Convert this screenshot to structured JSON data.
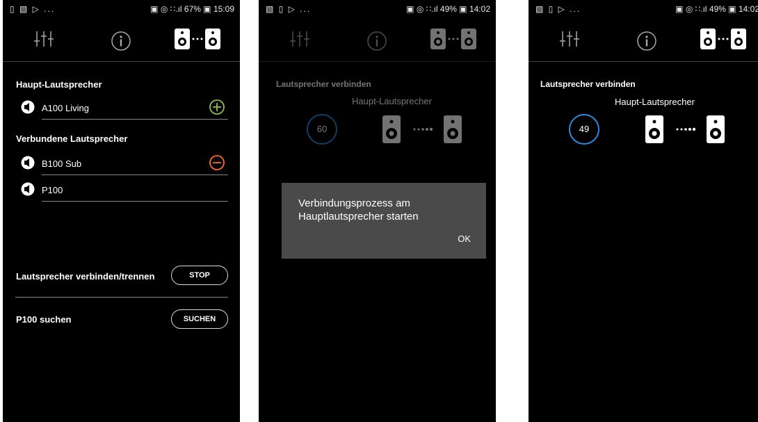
{
  "screens": [
    {
      "status": {
        "left": "▯ ▧ ▷ ...",
        "right": "▣ ◎ ∷.ıl 67% ▣ 15:09"
      },
      "main_speaker": {
        "title": "Haupt-Lautsprecher",
        "name": "A100 Living"
      },
      "connected": {
        "title": "Verbundene Lautsprecher",
        "items": [
          {
            "name": "B100 Sub"
          },
          {
            "name": "P100"
          }
        ]
      },
      "connect_control": {
        "label": "Lautsprecher verbinden/trennen",
        "button": "STOP"
      },
      "search_control": {
        "label": "P100 suchen",
        "button": "SUCHEN"
      }
    },
    {
      "status": {
        "left": "▧ ▯ ▷ ...",
        "right": "▣ ◎ ∷.ıl 49% ▣ 14:02"
      },
      "connect": {
        "title": "Lautsprecher verbinden",
        "subtitle": "Haupt-Lautsprecher",
        "countdown": "60"
      },
      "dialog": {
        "message": "Verbindungsprozess am Hauptlautsprecher starten",
        "ok": "OK"
      }
    },
    {
      "status": {
        "left": "▧ ▯ ▷ ...",
        "right": "▣ ◎ ∷.ıl 49% ▣ 14:02"
      },
      "connect": {
        "title": "Lautsprecher verbinden",
        "subtitle": "Haupt-Lautsprecher",
        "countdown": "49"
      }
    }
  ],
  "colors": {
    "add": "#8bc34a",
    "remove": "#ff6a2b",
    "ring": "#2d8ce0"
  },
  "icons": [
    "equalizer-icon",
    "info-icon",
    "speaker-link-icon",
    "speaker-icon",
    "add-icon",
    "remove-icon"
  ]
}
